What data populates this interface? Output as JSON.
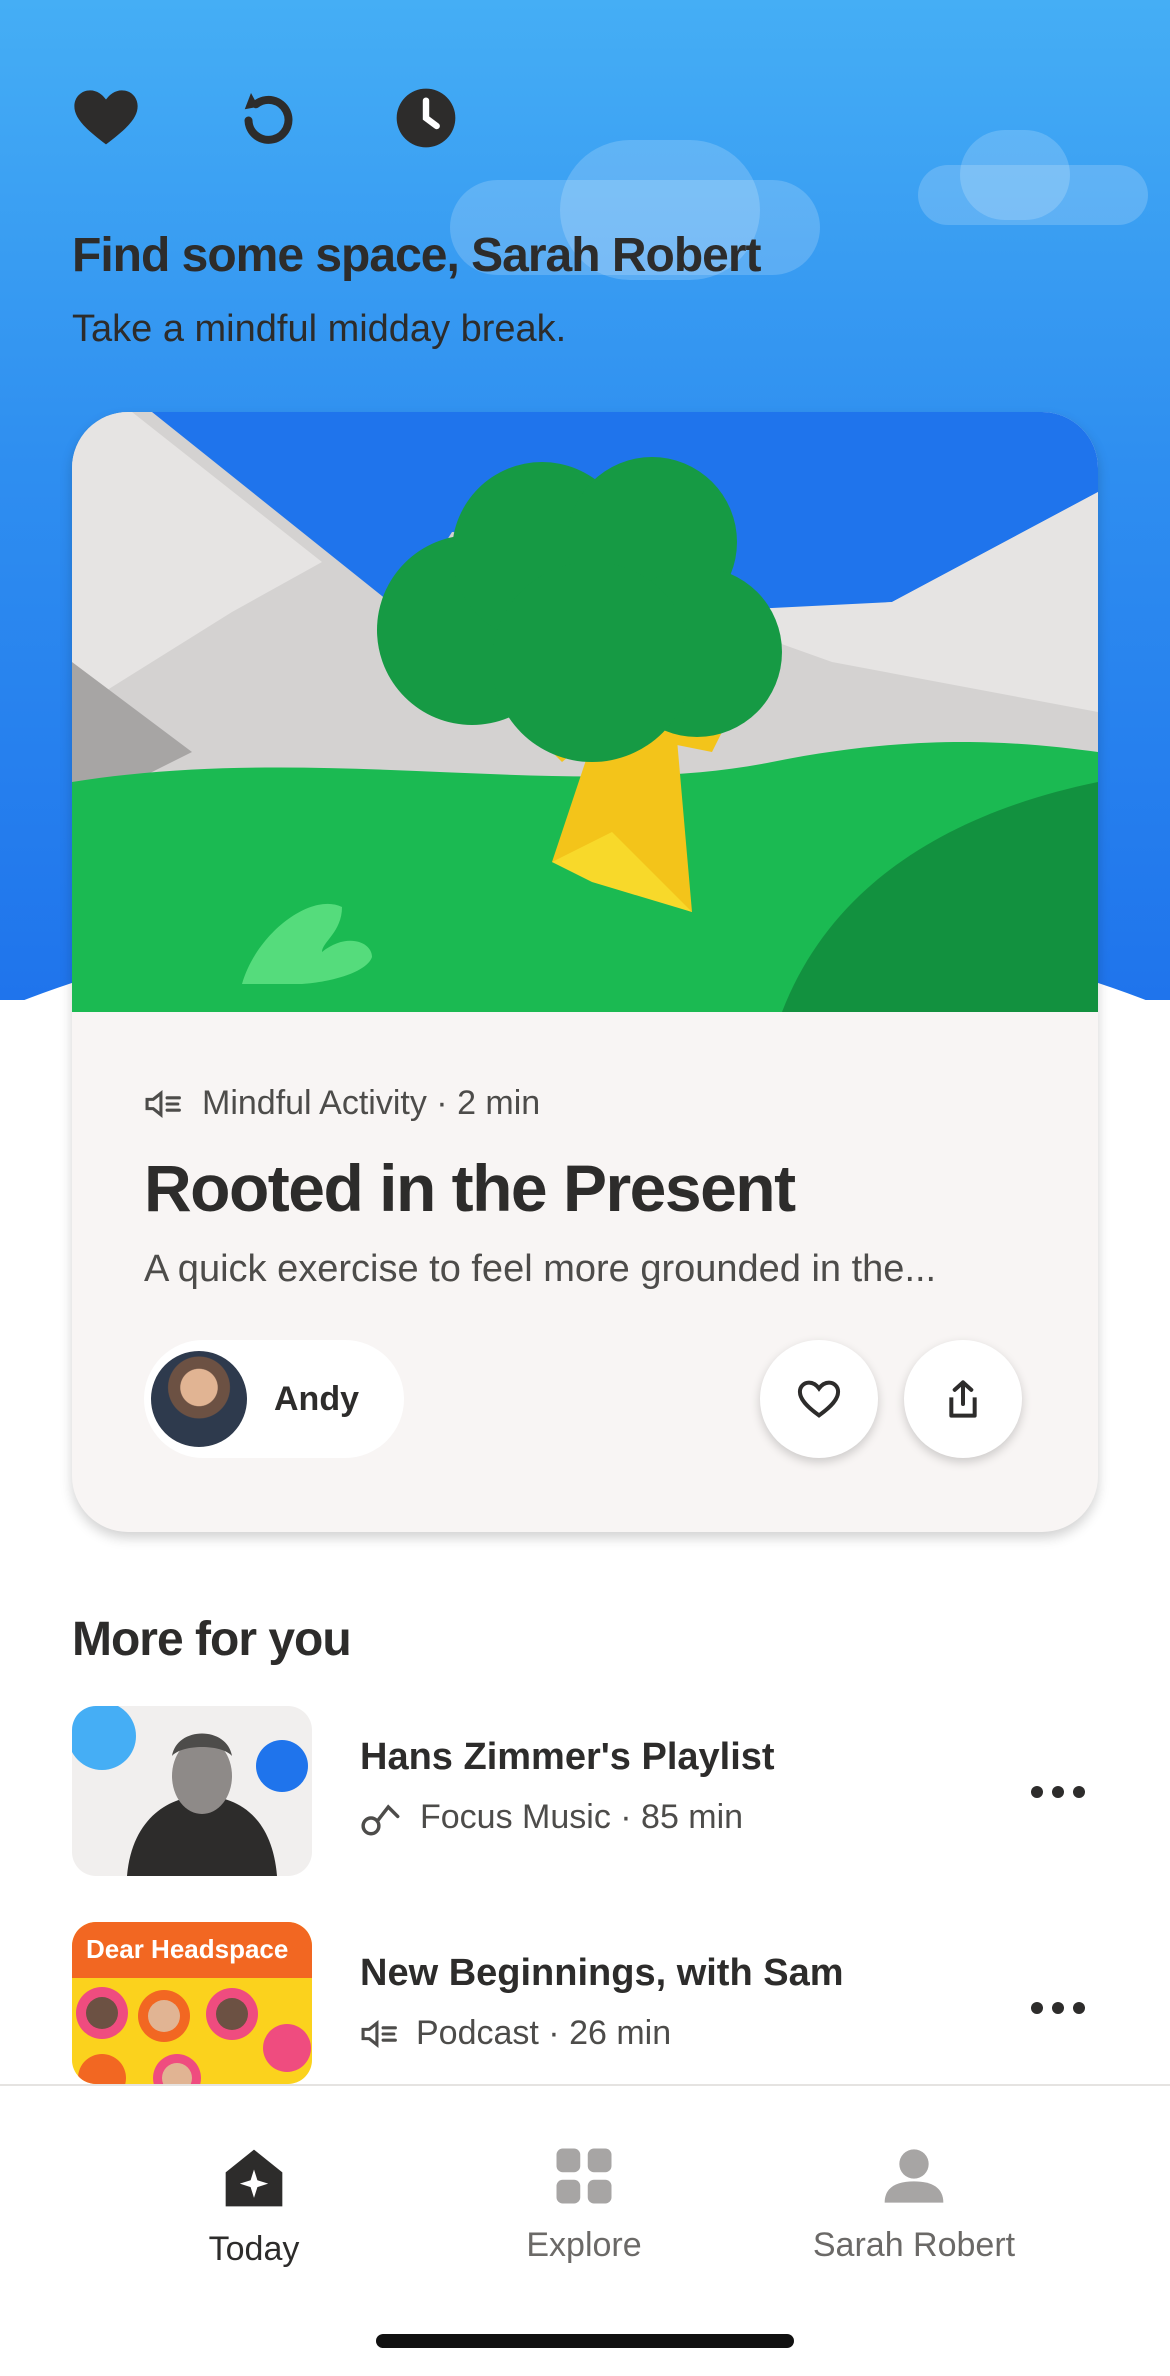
{
  "header": {
    "icons": [
      "heart-icon",
      "replay-icon",
      "clock-icon"
    ],
    "greeting_title": "Find some space, Sarah Robert",
    "greeting_subtitle": "Take a mindful midday break."
  },
  "featured": {
    "meta": "Mindful Activity · 2 min",
    "meta_icon": "speaker-icon",
    "title": "Rooted in the Present",
    "description": "A quick exercise to feel more grounded in the...",
    "teacher": "Andy",
    "actions": [
      "heart-icon",
      "share-icon"
    ]
  },
  "more_for_you": {
    "section_title": "More for you",
    "items": [
      {
        "title": "Hans Zimmer's Playlist",
        "meta": "Focus Music · 85 min",
        "icon": "music-note-icon"
      },
      {
        "title": "New Beginnings, with Sam",
        "meta": "Podcast · 26 min",
        "icon": "speaker-icon",
        "thumb_text": "Dear Headspace"
      }
    ]
  },
  "tabbar": {
    "tabs": [
      {
        "label": "Today",
        "icon": "home-icon",
        "active": true
      },
      {
        "label": "Explore",
        "icon": "grid-icon",
        "active": false
      },
      {
        "label": "Sarah Robert",
        "icon": "profile-icon",
        "active": false
      }
    ]
  },
  "colors": {
    "sky_top": "#45aef5",
    "sky_bottom": "#1f74ec",
    "grass": "#1bba52",
    "card_bg": "#f8f5f4",
    "text_primary": "#2d2c2b",
    "accent_orange": "#f26722"
  }
}
